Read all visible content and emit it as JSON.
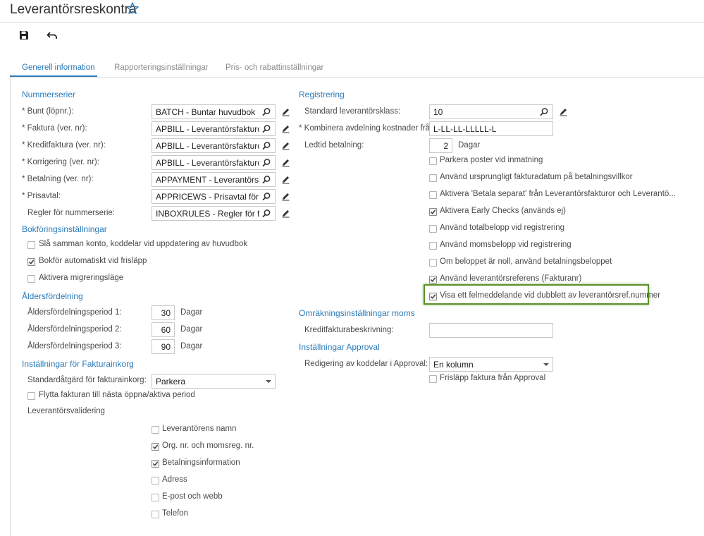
{
  "header": {
    "title": "Leverantörsreskontra",
    "star_icon": "star-icon",
    "save_icon": "save-icon",
    "undo_icon": "undo-icon"
  },
  "tabs": [
    {
      "label": "Generell information",
      "active": true
    },
    {
      "label": "Rapporteringsinställningar",
      "active": false
    },
    {
      "label": "Pris- och rabattinställningar",
      "active": false
    }
  ],
  "colors": {
    "accent": "#2a7ab8",
    "highlight": "#5c8f2a"
  },
  "nummerserier": {
    "title": "Nummerserier",
    "rows": [
      {
        "label": "Bunt (löpnr.):",
        "required": true,
        "value": "BATCH - Buntar huvudbok"
      },
      {
        "label": "Faktura (ver. nr):",
        "required": true,
        "value": "APBILL - Leverantörsfakturor"
      },
      {
        "label": "Kreditfaktura (ver. nr):",
        "required": true,
        "value": "APBILL - Leverantörsfakturor"
      },
      {
        "label": "Korrigering (ver. nr):",
        "required": true,
        "value": "APBILL - Leverantörsfakturor"
      },
      {
        "label": "Betalning (ver. nr):",
        "required": true,
        "value": "APPAYMENT - Leverantörsbetalningar"
      },
      {
        "label": "Prisavtal:",
        "required": true,
        "value": "APPRICEWS - Prisavtal för leverantörer"
      },
      {
        "label": "Regler för nummerserie:",
        "required": false,
        "value": "INBOXRULES - Regler för fakturor"
      }
    ]
  },
  "bokforing": {
    "title": "Bokföringsinställningar",
    "items": [
      {
        "label": "Slå samman konto, koddelar vid uppdatering av huvudbok",
        "checked": false
      },
      {
        "label": "Bokför automatiskt vid frisläpp",
        "checked": true
      },
      {
        "label": "Aktivera migreringsläge",
        "checked": false
      }
    ]
  },
  "aldersfordelning": {
    "title": "Åldersfördelning",
    "rows": [
      {
        "label": "Åldersfördelningsperiod 1:",
        "value": "30",
        "unit": "Dagar"
      },
      {
        "label": "Åldersfördelningsperiod 2:",
        "value": "60",
        "unit": "Dagar"
      },
      {
        "label": "Åldersfördelningsperiod 3:",
        "value": "90",
        "unit": "Dagar"
      }
    ]
  },
  "fakturainkorg": {
    "title": "Inställningar för Fakturainkorg",
    "standard_label": "Standardåtgärd för fakturainkorg:",
    "standard_value": "Parkera",
    "flytta_label": "Flytta fakturan till nästa öppna/aktiva period",
    "flytta_checked": false,
    "validering_label": "Leverantörsvalidering",
    "validering_items": [
      {
        "label": "Leverantörens namn",
        "checked": false
      },
      {
        "label": "Org. nr. och momsreg. nr.",
        "checked": true
      },
      {
        "label": "Betalningsinformation",
        "checked": true
      },
      {
        "label": "Adress",
        "checked": false
      },
      {
        "label": "E-post och webb",
        "checked": false
      },
      {
        "label": "Telefon",
        "checked": false
      }
    ]
  },
  "registrering": {
    "title": "Registrering",
    "klass_label": "Standard leverantörsklass:",
    "klass_value": "10",
    "kombinera_label": "Kombinera avdelning kostnader från:",
    "kombinera_value": "L-LL-LL-LLLLL-L",
    "ledtid_label": "Ledtid betalning:",
    "ledtid_value": "2",
    "ledtid_unit": "Dagar",
    "items": [
      {
        "label": "Parkera poster vid inmatning",
        "checked": false
      },
      {
        "label": "Använd ursprungligt fakturadatum på betalningsvillkor",
        "checked": false
      },
      {
        "label": "Aktivera 'Betala separat' från Leverantörsfakturor och Leverantö...",
        "checked": false
      },
      {
        "label": "Aktivera Early Checks (används ej)",
        "checked": true
      },
      {
        "label": "Använd totalbelopp vid registrering",
        "checked": false
      },
      {
        "label": "Använd momsbelopp vid registrering",
        "checked": false
      },
      {
        "label": "Om beloppet är noll, använd betalningsbeloppet",
        "checked": false
      },
      {
        "label": "Använd leverantörsreferens (Fakturanr)",
        "checked": true
      },
      {
        "label": "Visa ett felmeddelande vid dubblett av leverantörsref.nummer",
        "checked": true
      }
    ]
  },
  "omrakning": {
    "title": "Omräkningsinställningar moms",
    "kredit_label": "Kreditfakturabeskrivning:",
    "kredit_value": ""
  },
  "approval": {
    "title": "Inställningar Approval",
    "redigering_label": "Redigering av koddelar i Approval:",
    "redigering_value": "En kolumn",
    "frislapp_label": "Frisläpp faktura från Approval",
    "frislapp_checked": false
  }
}
